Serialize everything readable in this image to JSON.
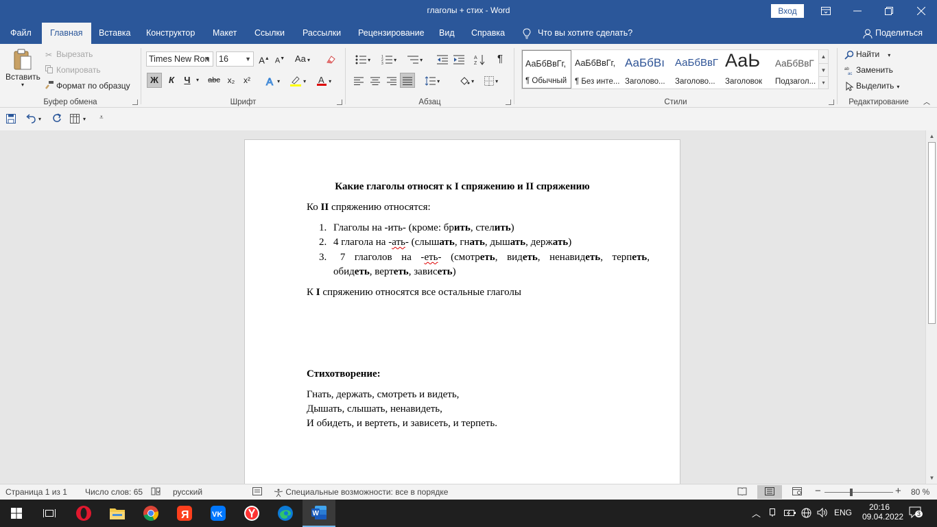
{
  "window": {
    "title": "глаголы + стих  -  Word",
    "signin_label": "Вход"
  },
  "tabs": {
    "items": [
      "Файл",
      "Главная",
      "Вставка",
      "Конструктор",
      "Макет",
      "Ссылки",
      "Рассылки",
      "Рецензирование",
      "Вид",
      "Справка"
    ],
    "tell_me": "Что вы хотите сделать?",
    "share": "Поделиться"
  },
  "ribbon": {
    "clipboard": {
      "paste_label": "Вставить",
      "cut_label": "Вырезать",
      "copy_label": "Копировать",
      "format_painter_label": "Формат по образцу",
      "group_label": "Буфер обмена"
    },
    "font": {
      "font_name": "Times New Ron",
      "font_size": "16",
      "bold": "Ж",
      "italic": "К",
      "underline": "Ч",
      "strikethrough": "abc",
      "subscript": "x₂",
      "superscript": "x²",
      "grow": "A",
      "shrink": "A",
      "case": "Aa",
      "group_label": "Шрифт"
    },
    "paragraph": {
      "pilcrow": "¶",
      "group_label": "Абзац"
    },
    "styles": {
      "items": [
        {
          "preview": "АаБбВвГг,",
          "name": "¶ Обычный"
        },
        {
          "preview": "АаБбВвГг,",
          "name": "¶ Без инте..."
        },
        {
          "preview": "АаБбВı",
          "name": "Заголово..."
        },
        {
          "preview": "АаБбВвГ",
          "name": "Заголово..."
        },
        {
          "preview": "АаЬ",
          "name": "Заголовок"
        },
        {
          "preview": "АаБбВвГ",
          "name": "Подзагол..."
        }
      ],
      "group_label": "Стили"
    },
    "editing": {
      "find_label": "Найти",
      "replace_label": "Заменить",
      "select_label": "Выделить",
      "group_label": "Редактирование"
    }
  },
  "document": {
    "heading": "Какие глаголы относят к I спряжению и II спряжению",
    "intro_ii": {
      "a": "Ко ",
      "b": "II",
      "c": " спряжению относятся:"
    },
    "list": [
      {
        "num": "1.",
        "a": "Глаголы на -ить- (кроме: бр",
        "b": "ить",
        "c": ", стел",
        "d": "ить",
        "e": ")"
      },
      {
        "num": "2.",
        "a": "4 глагола на -",
        "sq": "ать",
        "b": "- (слыш",
        "c": "ать",
        "d": ", гн",
        "e": "ать",
        "f": ", дыш",
        "g": "ать",
        "h": ", держ",
        "i": "ать",
        "j": ")"
      },
      {
        "num": "3.",
        "a": "7 глаголов на -",
        "sq": "еть",
        "b": "- (смотр",
        "c": "еть",
        "d": ", вид",
        "e": "еть",
        "f": ", ненавид",
        "g": "еть",
        "h": ", терп",
        "i": "еть",
        "j": ",",
        "a2": "обид",
        "b2": "еть",
        "c2": ", верт",
        "d2": "еть",
        "e2": ", завис",
        "f2": "еть",
        "g2": ")"
      }
    ],
    "intro_i": {
      "a": "К ",
      "b": "I",
      "c": " спряжению относятся все остальные глаголы"
    },
    "poem_title": "Стихотворение:",
    "poem_lines": [
      "Гнать, держать, смотреть и видеть,",
      "Дышать, слышать, ненавидеть,",
      "И обидеть, и вертеть, и зависеть, и терпеть."
    ]
  },
  "status": {
    "page": "Страница 1 из 1",
    "words": "Число слов: 65",
    "language": "русский",
    "accessibility": "Специальные возможности: все в порядке",
    "zoom": "80 %",
    "zoom_level_percent": 80
  },
  "taskbar": {
    "lang": "ENG",
    "time": "20:16",
    "date": "09.04.2022",
    "notifications": "3"
  },
  "colors": {
    "accent": "#2b579a",
    "ribbon_bg": "#f3f3f3",
    "canvas_bg": "#e6e6e6"
  }
}
